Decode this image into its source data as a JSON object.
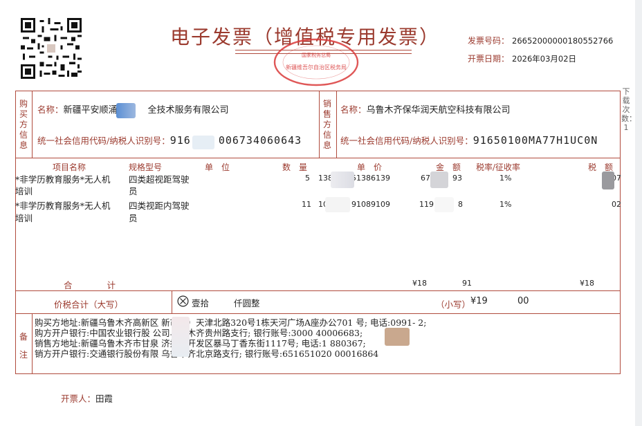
{
  "invoice": {
    "title": "电子发票（增值税专用发票）",
    "number_label": "发票号码：",
    "number": "26652000000180552766",
    "date_label": "开票日期：",
    "date": "2026年03月02日",
    "seal_text": "新疆维吾尔自治区税务局",
    "seal_sub": "国家税务总局"
  },
  "side_note": "下载次数：1",
  "buyer": {
    "section_label": [
      "购",
      "买",
      "方",
      "信",
      "息"
    ],
    "name_label": "名称：",
    "name": "新疆平安顺通______全技术服务有限公司",
    "name_a": "新疆平安顺涌",
    "name_b": "全技术服务有限公司",
    "tax_label": "统一社会信用代码/纳税人识别号：",
    "tax_a": "916",
    "tax_b": "006734060643"
  },
  "seller": {
    "section_label": [
      "销",
      "售",
      "方",
      "信",
      "息"
    ],
    "name_label": "名称：",
    "name": "乌鲁木齐保华润天航空科技有限公司",
    "tax_label": "统一社会信用代码/纳税人识别号：",
    "tax_id": "91650100MA77H1UC0N"
  },
  "table": {
    "headers": {
      "item": "项目名称",
      "spec": "规格型号",
      "unit": "单　位",
      "qty": "数　量",
      "price": "单　价",
      "amount": "金　额",
      "rate": "税率/征收率",
      "tax": "税　额"
    },
    "rows": [
      {
        "item_line1": "*非学历教育服务*无人机",
        "item_line2": "培训",
        "spec_line1": "四类超视距驾驶",
        "spec_line2": "员",
        "qty": "5",
        "price_a": "138",
        "price_b": "51386139",
        "amount_a": "67",
        "amount_b": "93",
        "rate": "1%",
        "tax": "07"
      },
      {
        "item_line1": "*非学历教育服务*无人机",
        "item_line2": "培训",
        "spec_line1": "四类视距内驾驶",
        "spec_line2": "员",
        "qty": "11",
        "price_a": "10",
        "price_b": "91089109",
        "amount_a": "119",
        "amount_b": "8",
        "rate": "1%",
        "tax": "02"
      }
    ],
    "total_label": "合　　　　计",
    "total_amount": "¥18",
    "total_amount_tail": "91",
    "total_tax": "¥18"
  },
  "grand_total": {
    "label": "价税合计（大写）",
    "icon": "cross-circle-icon",
    "words_a": "壹拾",
    "words_b": "仟圆整",
    "small_label": "（小写）",
    "small_a": "¥19",
    "small_b": "00"
  },
  "remarks": {
    "section_label": [
      "备",
      "注"
    ],
    "lines": [
      "购买方地址:新疆乌鲁木齐高新区        新市区）天津北路320号1栋天河广场A座办公701          号;        电话:0991-            2;",
      "购方开户银行:中国农业银行股        公司乌鲁木齐贵州路支行;          银行账号:3000         40006683;",
      "销售方地址:新疆乌鲁木齐市甘泉        济技术开发区暴马丁香东街1117号;        电话:1         880367;",
      "销方开户银行:交通银行股份有限          乌鲁木齐北京路支行;          银行账号:651651020        00016864"
    ]
  },
  "issuer": {
    "label": "开票人：",
    "name": "田霞"
  },
  "colors": {
    "accent": "#9b3a2e",
    "border": "#b04a3c",
    "text": "#222222"
  }
}
